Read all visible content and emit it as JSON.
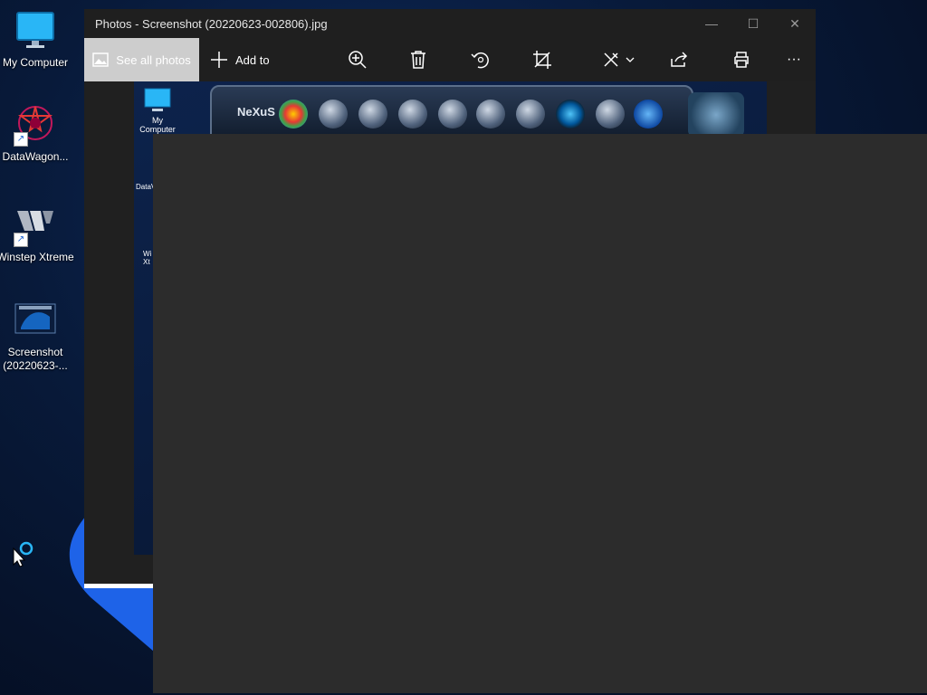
{
  "desktop": {
    "icons": [
      {
        "label": "My Computer",
        "icon": "monitor-icon"
      },
      {
        "label": "DataWagon...",
        "icon": "datawagon-icon"
      },
      {
        "label": "Winstep Xtreme",
        "icon": "winstep-icon"
      },
      {
        "label": "Screenshot (20220623-...",
        "icon": "screenshot-file-icon"
      }
    ]
  },
  "window": {
    "title": "Photos - Screenshot (20220623-002806).jpg",
    "controls": {
      "minimize": "—",
      "maximize": "☐",
      "close": "✕"
    }
  },
  "toolbar": {
    "see_all_photos": "See all photos",
    "add_to": "Add to",
    "more": "···"
  },
  "inner_screenshot": {
    "icon_label": "My Computer",
    "partial_label_1": "DataV",
    "partial_label_2": "Wi Xt",
    "dock_logo": "NeXuS"
  },
  "colors": {
    "accent": "#1a5fd0",
    "window_bg": "#1f1f1f",
    "overlay": "#2c2c2c"
  }
}
